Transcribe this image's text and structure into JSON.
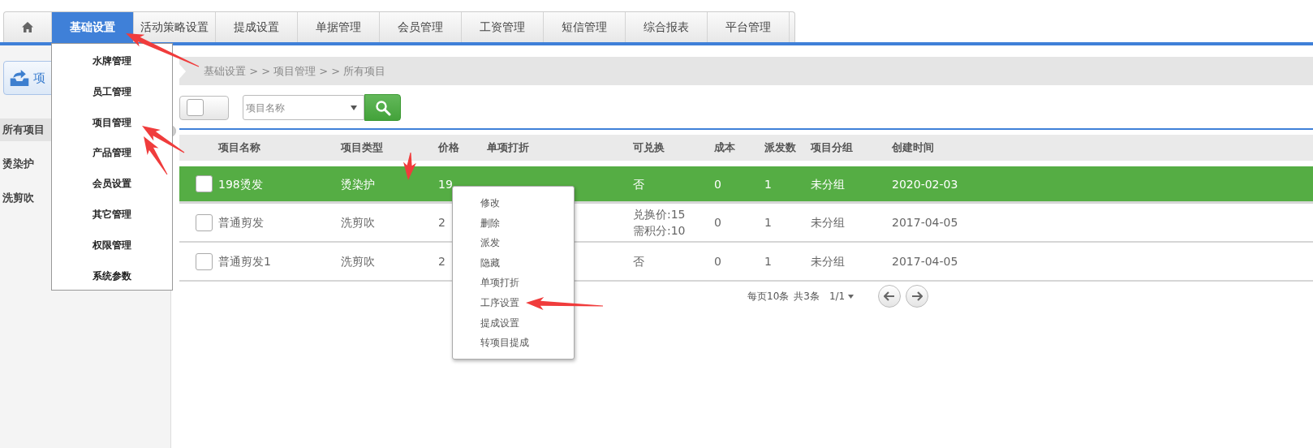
{
  "nav": {
    "tabs": [
      {
        "kind": "home",
        "selected": false
      },
      {
        "kind": "text",
        "label": "基础设置",
        "selected": true
      },
      {
        "kind": "text",
        "label": "活动策略设置",
        "selected": false
      },
      {
        "kind": "text",
        "label": "提成设置",
        "selected": false
      },
      {
        "kind": "text",
        "label": "单据管理",
        "selected": false
      },
      {
        "kind": "text",
        "label": "会员管理",
        "selected": false
      },
      {
        "kind": "text",
        "label": "工资管理",
        "selected": false
      },
      {
        "kind": "text",
        "label": "短信管理",
        "selected": false
      },
      {
        "kind": "text",
        "label": "综合报表",
        "selected": false
      },
      {
        "kind": "text",
        "label": "平台管理",
        "selected": false
      }
    ]
  },
  "dropdown": {
    "items": [
      "水牌管理",
      "员工管理",
      "项目管理",
      "产品管理",
      "会员设置",
      "其它管理",
      "权限管理",
      "系统参数"
    ]
  },
  "sidebar": {
    "button": {
      "label": "项"
    },
    "items": [
      {
        "label": "所有项目",
        "selected": true
      },
      {
        "label": "烫染护",
        "selected": false
      },
      {
        "label": "洗剪吹",
        "selected": false
      }
    ]
  },
  "breadcrumb": "基础设置 > > 项目管理 > > 所有项目",
  "toolbar": {
    "select_all": {
      "checked": false
    },
    "search": {
      "placeholder": "项目名称"
    }
  },
  "table": {
    "columns": [
      "项目名称",
      "项目类型",
      "价格",
      "单项打折",
      "可兑换",
      "成本",
      "派发数",
      "项目分组",
      "创建时间"
    ],
    "rows": [
      {
        "selected": true,
        "checked": false,
        "name": "198烫发",
        "type": "烫染护",
        "price": "19",
        "exchange": "否",
        "cost": "0",
        "dispatched": "1",
        "group": "未分组",
        "created": "2020-02-03"
      },
      {
        "selected": false,
        "checked": false,
        "name": "普通剪发",
        "type": "洗剪吹",
        "price": "2",
        "exchange": "兑换价:15\n需积分:10",
        "cost": "0",
        "dispatched": "1",
        "group": "未分组",
        "created": "2017-04-05"
      },
      {
        "selected": false,
        "checked": false,
        "name": "普通剪发1",
        "type": "洗剪吹",
        "price": "2",
        "exchange": "否",
        "cost": "0",
        "dispatched": "1",
        "group": "未分组",
        "created": "2017-04-05"
      }
    ]
  },
  "pagination": {
    "page_size": "每页10条",
    "total": "共3条",
    "page": "1/1"
  },
  "context_menu": {
    "items": [
      "修改",
      "删除",
      "派发",
      "隐藏",
      "单项打折",
      "工序设置",
      "提成设置",
      "转项目提成"
    ]
  }
}
